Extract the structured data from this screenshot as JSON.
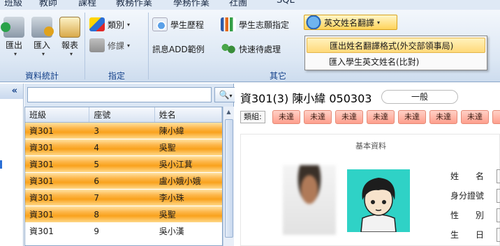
{
  "menu": {
    "tabs": [
      "班級",
      "教師",
      "課程",
      "教務作業",
      "學務作業",
      "社團",
      "SQL"
    ]
  },
  "ribbon": {
    "groups": {
      "data_stats": "資料統計",
      "assign": "指定",
      "other": "其它"
    },
    "export_label": "匯出",
    "import_label": "匯入",
    "report_label": "報表",
    "category_label": "類別",
    "course_label": "修課",
    "history_label": "學生歷程",
    "wish_label": "學生志願指定",
    "msg_label": "訊息ADD範例",
    "quick_label": "快速待處理",
    "english_name_label": "英文姓名翻譯"
  },
  "dropdown": {
    "items": [
      "匯出姓名翻譯格式(外交部領事局)",
      "匯入學生英文姓名(比對)"
    ]
  },
  "left_panel": {
    "collapse": "«"
  },
  "list": {
    "search_value": "",
    "search_icon": "search-icon",
    "go_label": ">>",
    "columns": [
      "班級",
      "座號",
      "姓名"
    ],
    "rows": [
      {
        "class": "資301",
        "seat": "3",
        "name": "陳小緯"
      },
      {
        "class": "資301",
        "seat": "4",
        "name": "吳聖"
      },
      {
        "class": "資301",
        "seat": "5",
        "name": "吳小江萁"
      },
      {
        "class": "資301",
        "seat": "6",
        "name": "盧小娥小娥"
      },
      {
        "class": "資301",
        "seat": "7",
        "name": "李小珠"
      },
      {
        "class": "資301",
        "seat": "8",
        "name": "吳聖"
      },
      {
        "class": "資301",
        "seat": "9",
        "name": "吳小漢"
      }
    ]
  },
  "detail": {
    "title": "資301(3) 陳小緯 050303",
    "status": "一般",
    "category_label": "類組:",
    "tags": [
      "未達",
      "未達",
      "未達",
      "未達",
      "未達",
      "未達",
      "未達",
      "未達"
    ],
    "card_title": "基本資料",
    "fields": [
      "姓　　名",
      "身分證號",
      "性　　別",
      "生　　日"
    ]
  },
  "colors": {
    "accent": "#15428b",
    "selected_row": "#f9a21d",
    "tag": "#ff9f8d"
  }
}
